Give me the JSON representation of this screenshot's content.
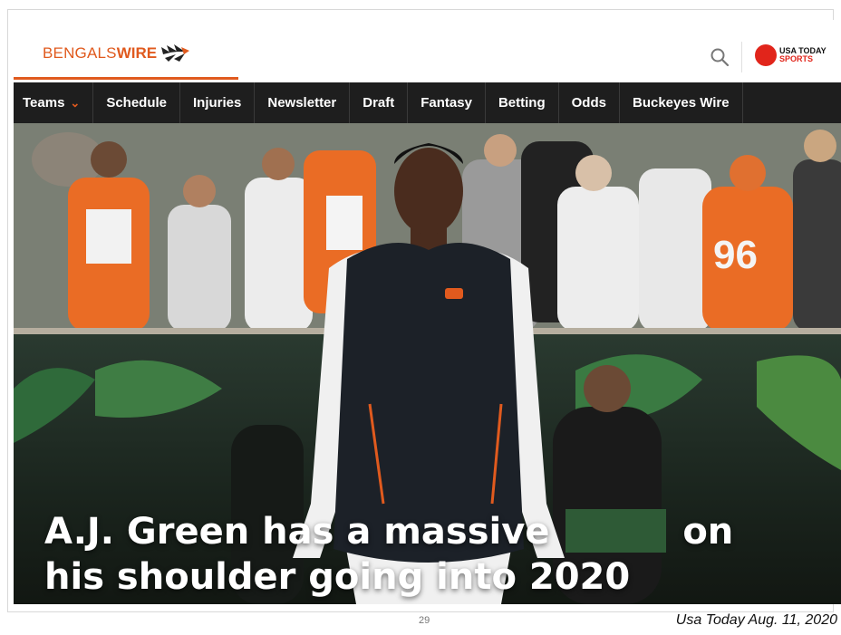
{
  "site": {
    "logo_part1": "BENGALS",
    "logo_part2": "WIRE",
    "partner_line1": "USA TODAY",
    "partner_line2": "SPORTS"
  },
  "nav": {
    "items": [
      "Teams",
      "Schedule",
      "Injuries",
      "Newsletter",
      "Draft",
      "Fantasy",
      "Betting",
      "Odds",
      "Buckeyes Wire"
    ],
    "dropdown_indicator": "chevron-down-icon"
  },
  "hero": {
    "headline_before": "A.J. Green has a massive",
    "headline_after": "on",
    "headline_line2": "his shoulder going into 2020",
    "jersey_number": "96"
  },
  "slide": {
    "page_number": "29",
    "credit": "Usa Today Aug. 11, 2020"
  },
  "colors": {
    "brand_orange": "#e05a1e",
    "nav_bg": "#1e1e1e",
    "usa_red": "#e1251b",
    "redaction_green": "#2e5a36"
  }
}
